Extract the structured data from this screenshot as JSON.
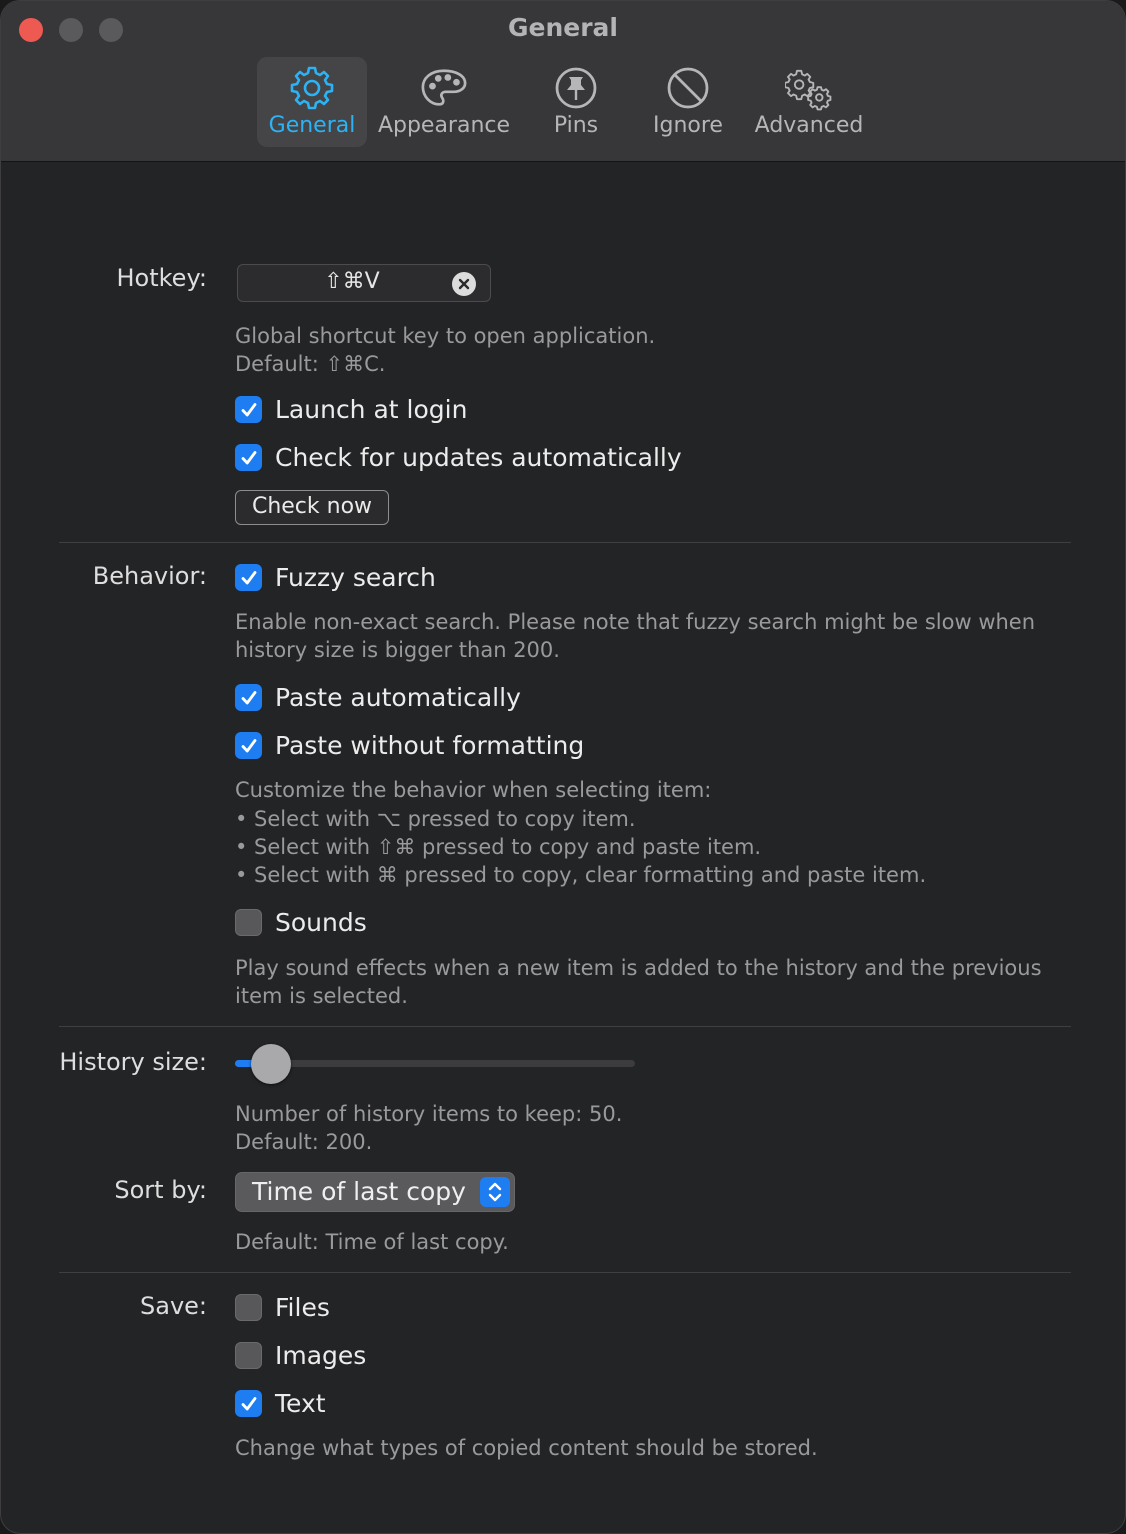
{
  "window": {
    "title": "General"
  },
  "tabs": [
    {
      "label": "General",
      "icon": "gear-icon",
      "active": true
    },
    {
      "label": "Appearance",
      "icon": "palette-icon",
      "active": false
    },
    {
      "label": "Pins",
      "icon": "pin-icon",
      "active": false
    },
    {
      "label": "Ignore",
      "icon": "prohibited-icon",
      "active": false
    },
    {
      "label": "Advanced",
      "icon": "gears-icon",
      "active": false
    }
  ],
  "hotkey": {
    "label": "Hotkey:",
    "value": "⇧⌘V",
    "help1": "Global shortcut key to open application.",
    "help2": "Default: ⇧⌘C."
  },
  "general": {
    "launch_at_login": {
      "label": "Launch at login",
      "checked": true
    },
    "check_updates": {
      "label": "Check for updates automatically",
      "checked": true
    },
    "check_now": "Check now"
  },
  "behavior": {
    "label": "Behavior:",
    "fuzzy_search": {
      "label": "Fuzzy search",
      "checked": true
    },
    "fuzzy_help1": "Enable non-exact search. Please note that fuzzy search might be slow when",
    "fuzzy_help2": "history size is bigger than 200.",
    "paste_automatically": {
      "label": "Paste automatically",
      "checked": true
    },
    "paste_without_formatting": {
      "label": "Paste without formatting",
      "checked": true
    },
    "select_help": [
      "Customize the behavior when selecting item:",
      "• Select with ⌥ pressed to copy item.",
      "• Select with ⇧⌘ pressed to copy and paste item.",
      "• Select with ⌘ pressed to copy, clear formatting and paste item."
    ],
    "sounds": {
      "label": "Sounds",
      "checked": false
    },
    "sounds_help1": "Play sound effects when a new item is added to the history and the previous",
    "sounds_help2": "item is selected."
  },
  "history": {
    "label": "History size:",
    "slider_fraction": 0.09,
    "help1": "Number of history items to keep: 50.",
    "help2": "Default: 200."
  },
  "sort": {
    "label": "Sort by:",
    "value": "Time of last copy",
    "help": "Default: Time of last copy."
  },
  "save": {
    "label": "Save:",
    "files": {
      "label": "Files",
      "checked": false
    },
    "images": {
      "label": "Images",
      "checked": false
    },
    "text": {
      "label": "Text",
      "checked": true
    },
    "help": "Change what types of copied content should be stored."
  },
  "colors": {
    "accent": "#1f7df2",
    "active_tab_text": "#2cb3f5",
    "close_button": "#ee5a52",
    "background": "#232426"
  }
}
